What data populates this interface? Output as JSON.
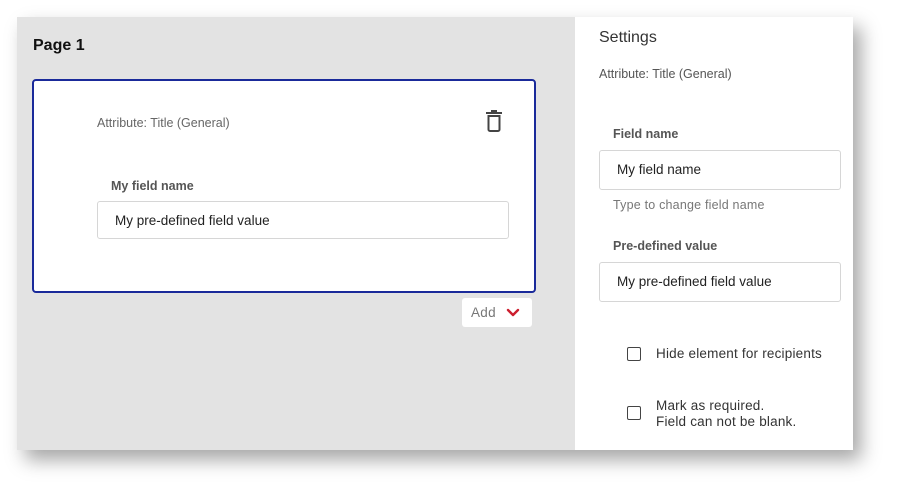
{
  "canvas": {
    "page_title": "Page 1",
    "card": {
      "attribute": "Attribute: Title (General)",
      "field_label": "My field name",
      "field_value": "My pre-defined field value",
      "delete_icon": "trash-icon"
    },
    "add_button": {
      "label": "Add",
      "icon": "chevron-down-icon",
      "icon_color": "#cc1f2f"
    }
  },
  "settings": {
    "title": "Settings",
    "attribute": "Attribute: Title (General)",
    "field_name_label": "Field name",
    "field_name_value": "My field name",
    "field_name_help": "Type to change field name",
    "predefined_label": "Pre-defined value",
    "predefined_value": "My pre-defined field value",
    "checkboxes": [
      {
        "label": "Hide element for recipients",
        "checked": false
      },
      {
        "label_line1": "Mark as required.",
        "label_line2": "Field can not be blank.",
        "checked": false
      }
    ]
  },
  "colors": {
    "accent_border": "#1a2a9a",
    "canvas_bg": "#e3e3e3"
  }
}
